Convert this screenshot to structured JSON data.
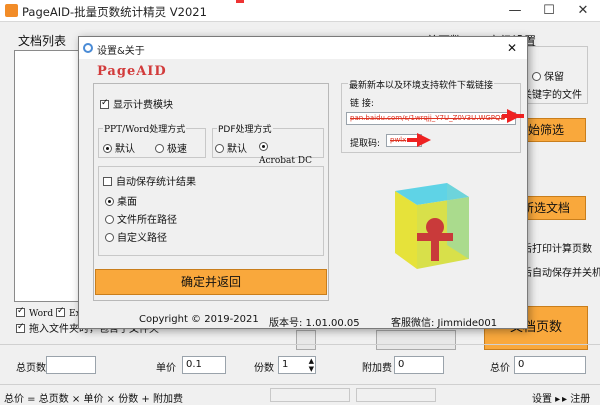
{
  "window": {
    "title": "PageAID-批量页数统计精灵 V2021"
  },
  "main": {
    "doc_list_label": "文档列表",
    "total_pages_header": "总页数",
    "advanced_settings_label": "高级设置",
    "keep_label": "保留",
    "keyword_file_label": "关键字的文件",
    "start_filter_button": "始筛选",
    "selected_docs_button": "所选文档",
    "print_calc_label": "后打印计算页数",
    "auto_save_shutdown_label": "后自动保存并关机",
    "word_checkbox": "Word",
    "excel_checkbox": "Exc",
    "drag_folder_label": "拖入文件夹时，包含子文件夹",
    "doc_pages_button": "文档页数",
    "total_pages_label": "总页数",
    "unit_price_label": "单价",
    "unit_price_value": "0.1",
    "copies_label": "份数",
    "copies_value": "1",
    "extra_fee_label": "附加费",
    "extra_fee_value": "0",
    "total_price_label": "总价",
    "total_price_value": "0",
    "formula": "总价 = 总页数 × 单价 × 份数 + 附加费",
    "settings_link": "设置",
    "register_link": "注册"
  },
  "dialog": {
    "title": "设置&关于",
    "logo": "PageAID",
    "show_billing_label": "显示计费模块",
    "ppt_word_group": "PPT/Word处理方式",
    "ppt_default": "默认",
    "ppt_fast": "极速",
    "pdf_group": "PDF处理方式",
    "pdf_default": "默认",
    "pdf_acrobat": "Acrobat DC",
    "auto_save_label": "自动保存统计结果",
    "desktop_option": "桌面",
    "file_path_option": "文件所在路径",
    "custom_path_option": "自定义路径",
    "confirm_button": "确定并返回",
    "download_group": "最新新本以及环境支持软件下载链接",
    "link_label": "链    接:",
    "link_value": "pan.baidu.com/s/1wrqjj_Y7U_Z0V3U.WGPQE",
    "code_label": "提取码:",
    "code_value": "pwlx",
    "copyright": "Copyright ©  2019-2021",
    "version": "版本号: 1.01.00.05",
    "wechat": "客服微信: Jimmide001"
  }
}
